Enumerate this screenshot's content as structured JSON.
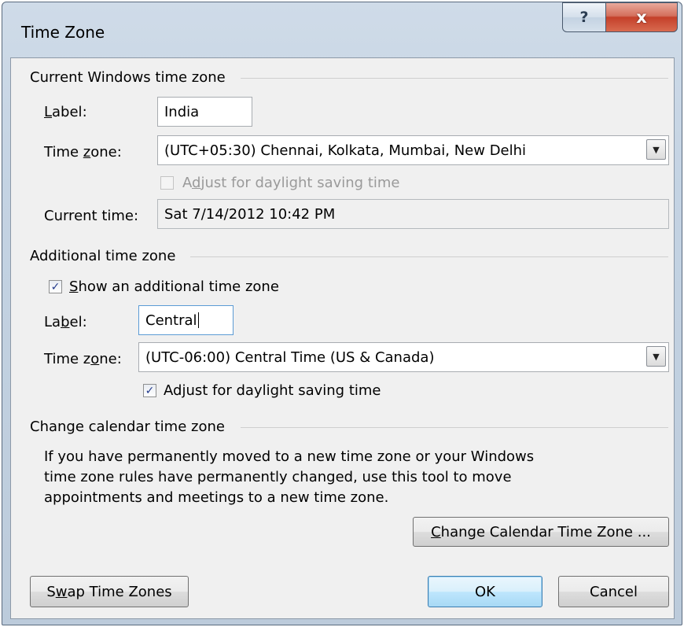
{
  "window": {
    "title": "Time Zone",
    "help_glyph": "?",
    "close_glyph": "x"
  },
  "current": {
    "section_title": "Current Windows time zone",
    "label_caption_pre": "",
    "label_caption_ul": "L",
    "label_caption_post": "abel:",
    "label_value": "India",
    "tz_caption_pre": "Time ",
    "tz_caption_ul": "z",
    "tz_caption_post": "one:",
    "tz_value": "(UTC+05:30) Chennai, Kolkata, Mumbai, New Delhi",
    "dst_pre": "A",
    "dst_ul": "d",
    "dst_post": "just for daylight saving time",
    "dst_checked": false,
    "dst_enabled": false,
    "time_caption": "Current time:",
    "time_value": "Sat 7/14/2012 10:42 PM"
  },
  "additional": {
    "section_title": "Additional time zone",
    "show_pre": "",
    "show_ul": "S",
    "show_post": "how an additional time zone",
    "show_checked": true,
    "label_caption_pre": "La",
    "label_caption_ul": "b",
    "label_caption_post": "el:",
    "label_value": "Central",
    "tz_caption_pre": "Time z",
    "tz_caption_ul": "o",
    "tz_caption_post": "ne:",
    "tz_value": "(UTC-06:00) Central Time (US & Canada)",
    "dst_pre": "Ad",
    "dst_ul": "j",
    "dst_post": "ust for daylight saving time",
    "dst_checked": true
  },
  "calendar": {
    "section_title": "Change calendar time zone",
    "line1": "If you have permanently moved to a new time zone or your Windows",
    "line2": "time zone rules have permanently changed, use this tool to move",
    "line3": "appointments and meetings to a new time zone.",
    "button_ul": "C",
    "button_post": "hange Calendar Time Zone ..."
  },
  "footer": {
    "swap_pre": "S",
    "swap_ul": "w",
    "swap_post": "ap Time Zones",
    "ok_label": "OK",
    "cancel_label": "Cancel"
  },
  "icons": {
    "combo_arrow": "▼",
    "check_mark": "✓"
  },
  "colors": {
    "close_button": "#c4402a",
    "default_button_border": "#3c7fb1",
    "check_mark": "#223a8c"
  }
}
